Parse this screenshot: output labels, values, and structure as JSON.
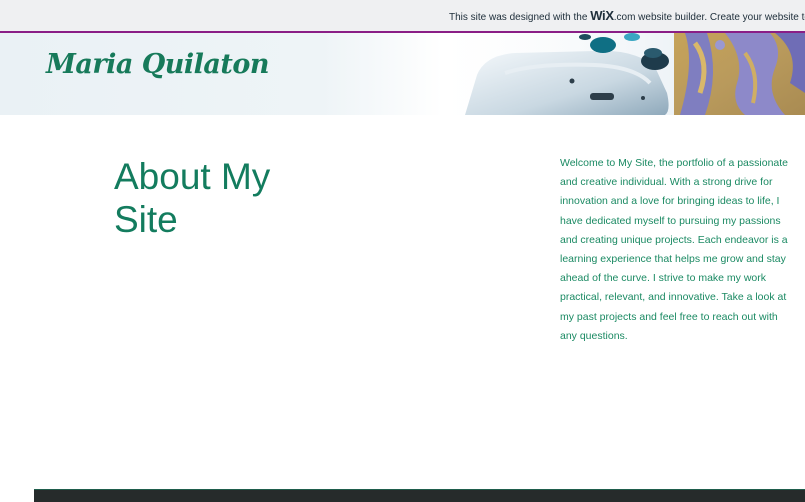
{
  "wix_banner": {
    "prefix": "This site was designed with the ",
    "logo": "WiX",
    "suffix": ".com website builder. Create your website today."
  },
  "header": {
    "site_title": "Maria Quilaton"
  },
  "about": {
    "heading": "About My Site",
    "body": "Welcome to My Site, the portfolio of a passionate and creative individual. With a strong drive for innovation and a love for bringing ideas to life, I have dedicated myself to pursuing my passions and creating unique projects. Each endeavor is a learning experience that helps me grow and stay ahead of the curve. I strive to make my work practical, relevant, and innovative. Take a look at my past projects and feel free to reach out with any questions."
  },
  "colors": {
    "accent_green": "#137c5e",
    "banner_border": "#8a1e86",
    "footer_bg": "#262b2b"
  }
}
